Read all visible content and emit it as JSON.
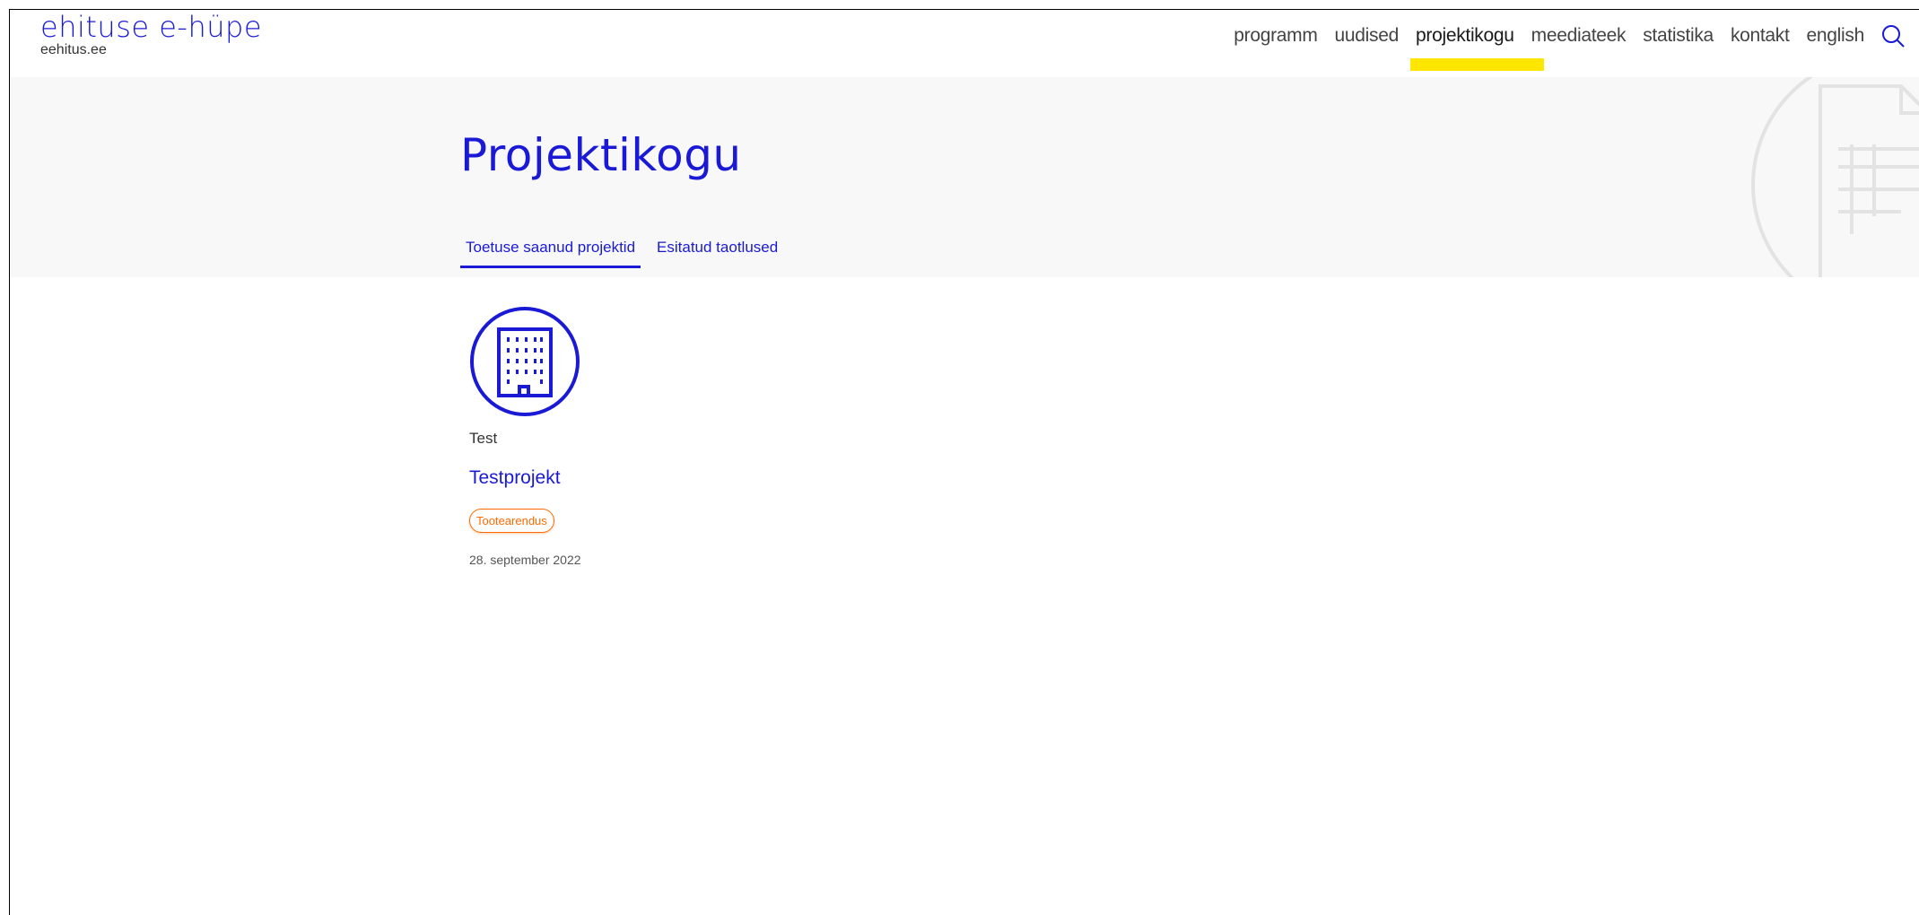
{
  "site": {
    "title": "ehituse e-hüpe",
    "subtitle": "eehitus.ee"
  },
  "nav": {
    "items": [
      {
        "label": "programm"
      },
      {
        "label": "uudised"
      },
      {
        "label": "projektikogu",
        "active": true
      },
      {
        "label": "meediateek"
      },
      {
        "label": "statistika"
      },
      {
        "label": "kontakt"
      },
      {
        "label": "english"
      }
    ],
    "search_icon": "search-icon"
  },
  "hero": {
    "title": "Projektikogu",
    "tabs": [
      {
        "label": "Toetuse saanud projektid",
        "active": true
      },
      {
        "label": "Esitatud taotlused",
        "active": false
      }
    ],
    "decoration_icon": "document-table-icon"
  },
  "projects": [
    {
      "icon": "building-icon",
      "category": "Test",
      "title": "Testprojekt",
      "tag": "Tootearendus",
      "date": "28. september 2022"
    }
  ],
  "colors": {
    "brand_blue": "#1a1ad6",
    "highlight_yellow": "#ffe600",
    "tag_orange": "#ff6a00",
    "hero_bg": "#f8f8f8"
  }
}
